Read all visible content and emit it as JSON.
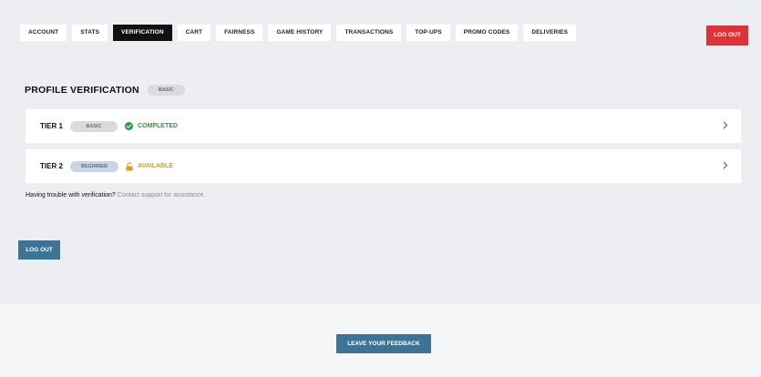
{
  "nav": {
    "tabs": [
      {
        "label": "ACCOUNT"
      },
      {
        "label": "STATS"
      },
      {
        "label": "VERIFICATION"
      },
      {
        "label": "CART"
      },
      {
        "label": "FAIRNESS"
      },
      {
        "label": "GAME HISTORY"
      },
      {
        "label": "TRANSACTIONS"
      },
      {
        "label": "TOP-UPS"
      },
      {
        "label": "PROMO CODES"
      },
      {
        "label": "DELIVERIES"
      }
    ],
    "active_tab": "VERIFICATION",
    "logout_label": "LOG OUT"
  },
  "verification": {
    "title": "PROFILE VERIFICATION",
    "level_badge": "BASIC",
    "tiers": [
      {
        "name": "TIER 1",
        "badge": "BASIC",
        "status": "COMPLETED",
        "status_icon": "check-circle-icon"
      },
      {
        "name": "TIER 2",
        "badge": "BEGINNER",
        "status": "AVAILABLE",
        "status_icon": "unlock-icon"
      }
    ],
    "trouble_text": "Having trouble with verification?",
    "support_link": "Contact support for assistance."
  },
  "actions": {
    "logout_label": "LOG OUT"
  },
  "footer": {
    "feedback_label": "LEAVE YOUR FEEDBACK"
  },
  "colors": {
    "danger": "#dc3238",
    "primary": "#3d7496",
    "success": "#2e9b3d",
    "warning": "#e39b1e",
    "background": "#edeef1"
  }
}
